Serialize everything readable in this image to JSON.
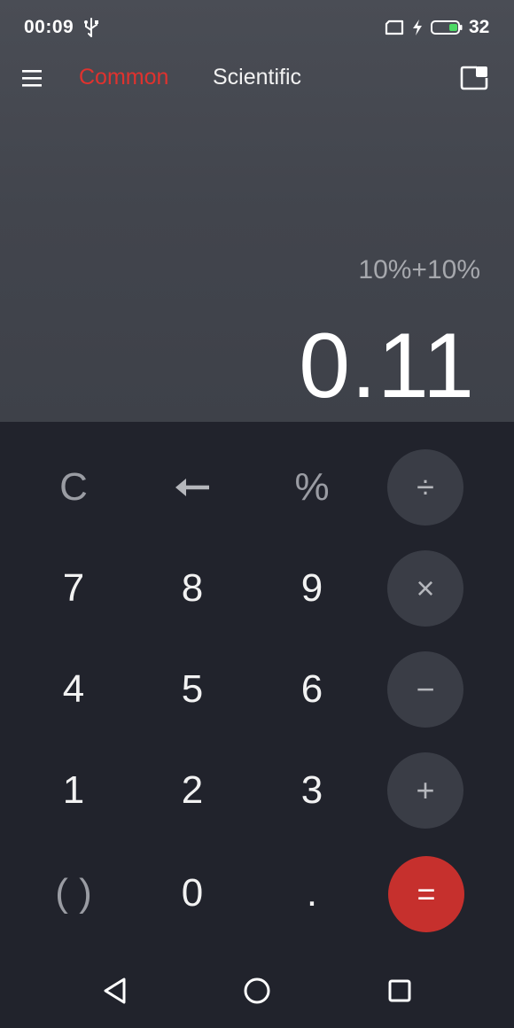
{
  "status_bar": {
    "time": "00:09",
    "battery_level": "32",
    "icons": [
      "usb-icon",
      "sim-icon",
      "charging-icon",
      "battery-icon"
    ]
  },
  "header": {
    "tabs": [
      {
        "label": "Common",
        "active": true
      },
      {
        "label": "Scientific",
        "active": false
      }
    ],
    "icons": [
      "menu-icon",
      "floating-window-icon"
    ]
  },
  "display": {
    "expression": "10%+10%",
    "result": "0.11"
  },
  "keypad": {
    "clear": "C",
    "percent": "%",
    "parentheses": "( )",
    "decimal": ".",
    "digits": {
      "d0": "0",
      "d1": "1",
      "d2": "2",
      "d3": "3",
      "d4": "4",
      "d5": "5",
      "d6": "6",
      "d7": "7",
      "d8": "8",
      "d9": "9"
    },
    "operators": {
      "divide": "÷",
      "multiply": "×",
      "subtract": "−",
      "add": "+",
      "equals": "="
    },
    "icons": [
      "backspace-icon"
    ]
  },
  "nav_bar": {
    "icons": [
      "back-icon",
      "home-icon",
      "recents-icon"
    ]
  },
  "colors": {
    "accent": "#e0322e",
    "equals_button": "#c6302d",
    "keypad_bg": "#21232c",
    "display_bg": "#42454d",
    "operator_button": "#3a3d46"
  }
}
